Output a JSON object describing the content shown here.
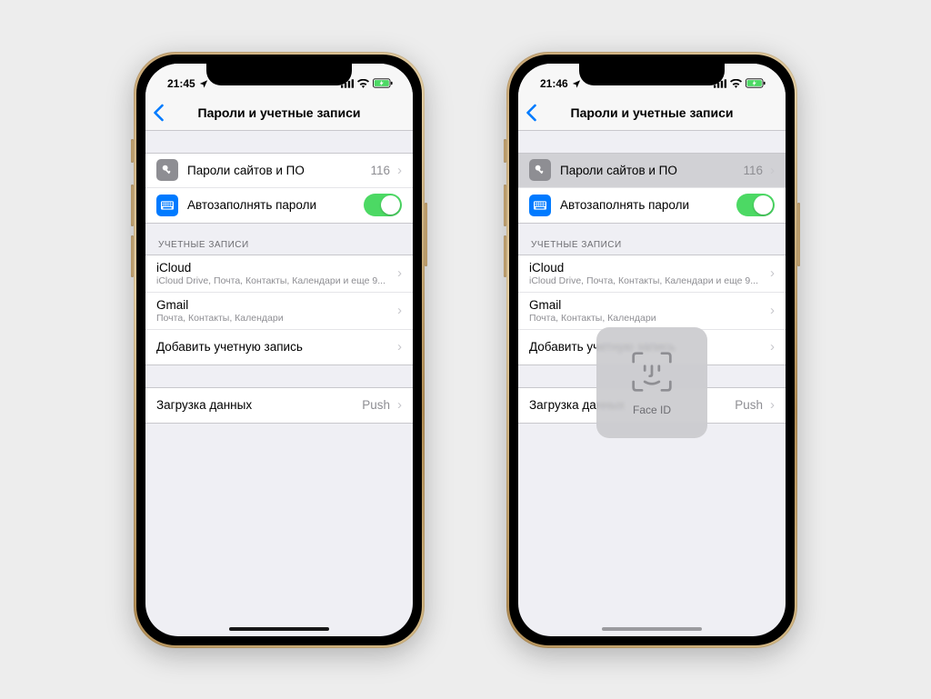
{
  "left": {
    "status_time": "21:45",
    "nav_title": "Пароли и учетные записи",
    "passwords_label": "Пароли сайтов и ПО",
    "passwords_count": "116",
    "autofill_label": "Автозаполнять пароли",
    "section_accounts": "УЧЕТНЫЕ ЗАПИСИ",
    "icloud_label": "iCloud",
    "icloud_sub": "iCloud Drive, Почта, Контакты, Календари и еще 9...",
    "gmail_label": "Gmail",
    "gmail_sub": "Почта, Контакты, Календари",
    "add_account": "Добавить учетную запись",
    "fetch_label": "Загрузка данных",
    "fetch_value": "Push"
  },
  "right": {
    "status_time": "21:46",
    "nav_title": "Пароли и учетные записи",
    "passwords_label": "Пароли сайтов и ПО",
    "passwords_count": "116",
    "autofill_label": "Автозаполнять пароли",
    "section_accounts": "УЧЕТНЫЕ ЗАПИСИ",
    "icloud_label": "iCloud",
    "icloud_sub": "iCloud Drive, Почта, Контакты, Календари и еще 9...",
    "gmail_label": "Gmail",
    "gmail_sub": "Почта, Контакты, Календари",
    "add_account": "Добавить учетную запись",
    "fetch_label": "Загрузка данных",
    "fetch_value": "Push",
    "faceid_label": "Face ID"
  }
}
